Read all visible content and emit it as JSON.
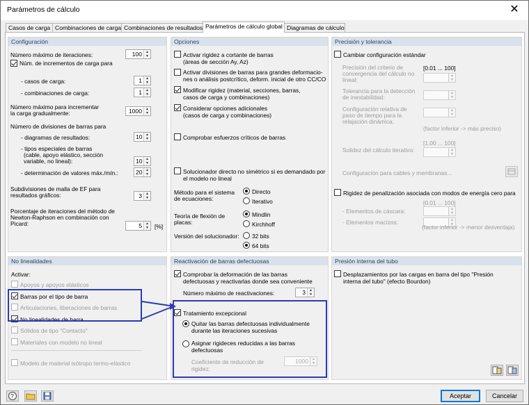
{
  "window": {
    "title": "Parámetros de cálculo",
    "close_glyph": "✕"
  },
  "tabs": [
    {
      "label": "Casos de carga"
    },
    {
      "label": "Combinaciones de carga"
    },
    {
      "label": "Combinaciones de resultados"
    },
    {
      "label": "Parámetros de cálculo global"
    },
    {
      "label": "Diagramas de cálculo"
    }
  ],
  "config": {
    "title": "Configuración",
    "max_iter_label": "Número máximo de iteraciones:",
    "max_iter_value": "100",
    "num_incr_label": "Núm. de incrementos de carga para",
    "casos_label": "- casos de carga:",
    "casos_value": "1",
    "comb_label": "- combinaciones de carga:",
    "comb_value": "1",
    "max_num_label1": "Número máximo para incrementar",
    "max_num_label2": "la carga gradualmente:",
    "max_num_value": "1000",
    "num_div_label": "Número de divisiones de barras para",
    "diag_label": "- diagramas de resultados:",
    "diag_value": "10",
    "tipos_label1": "- tipos especiales de barras",
    "tipos_label2": "(cable, apoyo elástico, sección",
    "tipos_label3": "variable, no lineal):",
    "tipos_value": "10",
    "det_label": "- determinación de valores máx./mín.:",
    "det_value": "20",
    "subdiv_label1": "Subdivisiones de malla de EF para",
    "subdiv_label2": "resultados gráficos:",
    "subdiv_value": "3",
    "porc_label1": "Porcentaje de iteraciones del método de",
    "porc_label2": "Newton-Raphson en combinación con",
    "porc_label3": "Picard:",
    "porc_value": "5",
    "porc_unit": "[%]"
  },
  "opciones": {
    "title": "Opciones",
    "o1a": "Activar rigidez a cortante de barras",
    "o1b": "(áreas de sección Ay, Az)",
    "o2a": "Activar divisiones de barras para grandes deformacio-",
    "o2b": "nes o análisis postcrítico, deform. inicial de otro CC/CO",
    "o3a": "Modificar rigidez (material, secciones, barras,",
    "o3b": "casos de carga y combinaciones)",
    "o4a": "Considerar opciones adicionales",
    "o4b": "(casos de carga y combinaciones)",
    "o5": "Comprobar esfuerzos críticos de barras",
    "o6a": "Solucionador directo no simétrico si es demandado por",
    "o6b": "el modelo no lineal",
    "metodo_label1": "Método para el sistema",
    "metodo_label2": "de ecuaciones:",
    "metodo_r1": "Directo",
    "metodo_r2": "Iterativo",
    "teoria_label1": "Teoría de flexión de",
    "teoria_label2": "placas:",
    "teoria_r1": "Mindlin",
    "teoria_r2": "Kirchhoff",
    "version_label": "Versión del solucionador:",
    "version_r1": "32 bits",
    "version_r2": "64 bits"
  },
  "precision": {
    "title": "Precisión y tolerancia",
    "cambiar": "Cambiar configuración estándar",
    "p1a": "Precisión del criterio de",
    "p1b": "convergencia del cálculo no",
    "p1c": "lineal:",
    "range1": "[0.01 ... 100]",
    "p2a": "Tolerancia para la detección",
    "p2b": "de inestabilidad:",
    "p3a": "Configuración relativa de",
    "p3b": "paso de tiempo para la",
    "p3c": "relajación dinámica:",
    "factor1": "(factor inferior -> más preciso)",
    "range2": "[1.00 ... 100]",
    "solidez": "Solidez del cálculo iterativo:",
    "cables": "Configuración para cables y membranas...",
    "rigidez": "Rigidez de penalización asociada con modos de energía cero para",
    "range3": "[0.01 ... 100]",
    "cascara": "- Elementos de cáscara:",
    "macizos": "- Elementos macizos:",
    "factor2": "(factor inferior -> menor desventaja)"
  },
  "nolineal": {
    "title": "No linealidades",
    "activar": "Activar:",
    "n1": "Apoyos y apoyos elásticos",
    "n2": "Barras por el tipo de barra",
    "n3": "Articulaciones, liberaciones de barras",
    "n4": "No linealidades de barra",
    "n5": "Sólidos de tipo \"Contacto\"",
    "n6": "Materiales con modelo no lineal",
    "n7": "Modelo de material isótropo termo-elástico"
  },
  "reactivacion": {
    "title": "Reactivación de barras defectuosas",
    "r1a": "Comprobar la deformación de las barras",
    "r1b": "defectuosas y reactivarlas donde sea conveniente",
    "max_label": "Número máximo de reactivaciones:",
    "max_value": "3",
    "trat": "Tratamiento excepcional",
    "q1a": "Quitar las barras defectuosas individualmente",
    "q1b": "durante las iteraciones sucesivas",
    "q2a": "Asignar rigideces reducidas a las barras",
    "q2b": "defectuosas",
    "coef_a": "Coeficiente de reducción de",
    "coef_b": "rigidez:",
    "coef_value": "1000"
  },
  "presion": {
    "title": "Presión interna del tubo",
    "p1a": "Desplazamientos por las cargas en barra del tipo \"Presión",
    "p1b": "interna del tubo\" (efecto Bourdon)"
  },
  "footer": {
    "accept": "Aceptar",
    "cancel": "Cancelar"
  }
}
